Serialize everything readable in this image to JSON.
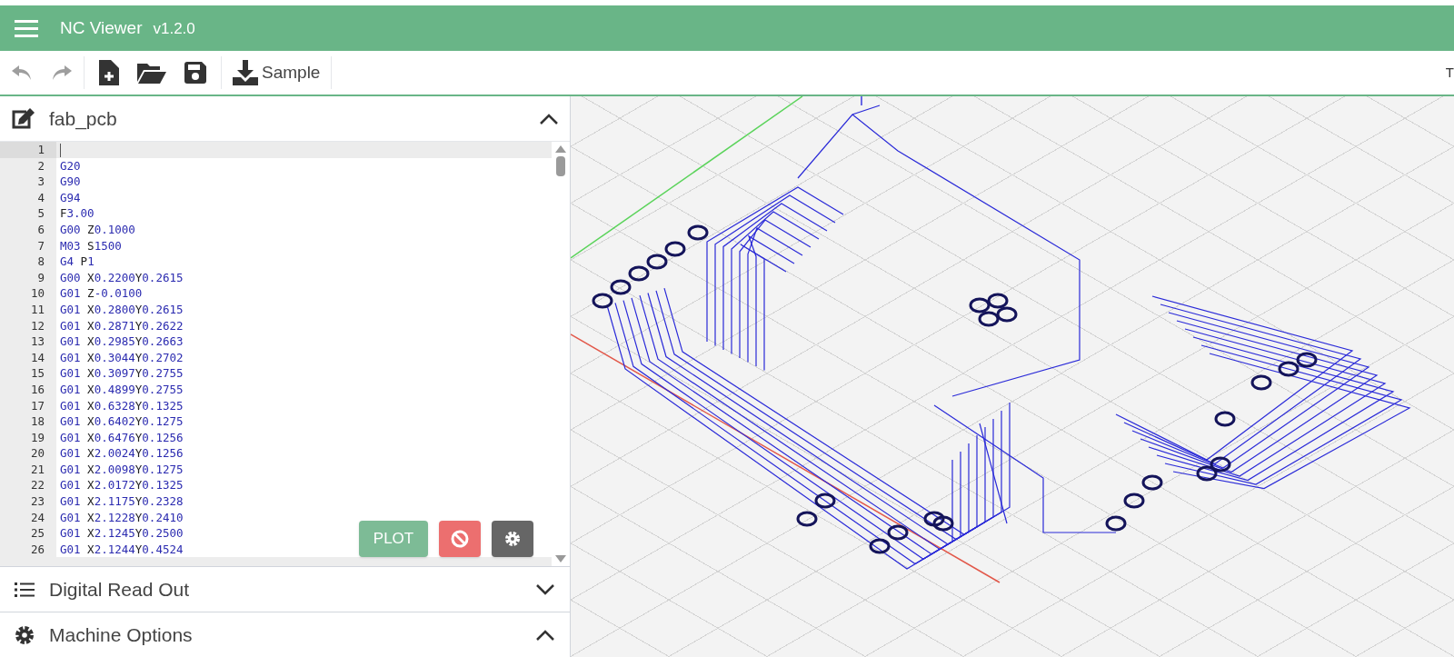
{
  "app_bar": {
    "title": "NC Viewer",
    "version": "v1.2.0"
  },
  "toolbar": {
    "sample_label": "Sample",
    "right_text": "T"
  },
  "editor_panel": {
    "title": "fab_pcb",
    "expanded": true,
    "lines": [
      {
        "number": "1",
        "active": true
      },
      {
        "number": "2",
        "code": "G20",
        "active": false
      },
      {
        "number": "3",
        "code": "G90",
        "active": false
      },
      {
        "number": "4",
        "code": "G94",
        "active": false
      },
      {
        "number": "5",
        "code": "F3.00",
        "active": false
      },
      {
        "number": "6",
        "code": "G00 Z0.1000",
        "active": false
      },
      {
        "number": "7",
        "code": "M03 S1500",
        "active": false
      },
      {
        "number": "8",
        "code": "G4 P1",
        "active": false
      },
      {
        "number": "9",
        "code": "G00 X0.2200Y0.2615",
        "active": false
      },
      {
        "number": "10",
        "code": "G01 Z-0.0100",
        "active": false
      },
      {
        "number": "11",
        "code": "G01 X0.2800Y0.2615",
        "active": false
      },
      {
        "number": "12",
        "code": "G01 X0.2871Y0.2622",
        "active": false
      },
      {
        "number": "13",
        "code": "G01 X0.2985Y0.2663",
        "active": false
      },
      {
        "number": "14",
        "code": "G01 X0.3044Y0.2702",
        "active": false
      },
      {
        "number": "15",
        "code": "G01 X0.3097Y0.2755",
        "active": false
      },
      {
        "number": "16",
        "code": "G01 X0.4899Y0.2755",
        "active": false
      },
      {
        "number": "17",
        "code": "G01 X0.6328Y0.1325",
        "active": false
      },
      {
        "number": "18",
        "code": "G01 X0.6402Y0.1275",
        "active": false
      },
      {
        "number": "19",
        "code": "G01 X0.6476Y0.1256",
        "active": false
      },
      {
        "number": "20",
        "code": "G01 X2.0024Y0.1256",
        "active": false
      },
      {
        "number": "21",
        "code": "G01 X2.0098Y0.1275",
        "active": false
      },
      {
        "number": "22",
        "code": "G01 X2.0172Y0.1325",
        "active": false
      },
      {
        "number": "23",
        "code": "G01 X2.1175Y0.2328",
        "active": false
      },
      {
        "number": "24",
        "code": "G01 X2.1228Y0.2410",
        "active": false
      },
      {
        "number": "25",
        "code": "G01 X2.1245Y0.2500",
        "active": false
      },
      {
        "number": "26",
        "code": "G01 X2.1244Y0.4524",
        "active": false
      }
    ],
    "plot_button": "PLOT"
  },
  "sections": [
    {
      "kind": "list",
      "title": "Digital Read Out",
      "expanded": false
    },
    {
      "kind": "gear",
      "title": "Machine Options",
      "expanded": true
    }
  ]
}
